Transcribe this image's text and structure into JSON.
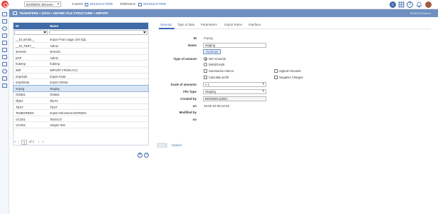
{
  "topbar": {
    "user_value": "BGREEN::BGreen",
    "current_label": "Current",
    "current_link": "201412ACT000",
    "reference_label": "Reference",
    "reference_link": "201312ACT000",
    "notification_count": "0",
    "help_glyph": "?",
    "brand_color": "#e8423c"
  },
  "titlebar": {
    "breadcrumb": "TRANSFERS » DATA » DEFINE FILE STRUCTURE » IMPORT",
    "right_text": "BGSBATCHadmin",
    "color": "#6e8fc0"
  },
  "grid": {
    "col_id": "ID",
    "col_name": "Name",
    "rows": [
      {
        "id": "__DI_BASE__",
        "name": "Import From Sage 100 SQL"
      },
      {
        "id": "__DI_TEST__",
        "name": "Admin"
      },
      {
        "id": "demo01",
        "name": "demo01"
      },
      {
        "id": "EXP",
        "name": "Admin"
      },
      {
        "id": "hubImp",
        "name": "hubImp"
      },
      {
        "id": "IMP",
        "name": "IMPORT FROM ACC"
      },
      {
        "id": "ImpHUB",
        "name": "Import HUB"
      },
      {
        "id": "ImpOData",
        "name": "Import OData"
      },
      {
        "id": "ImpSg",
        "name": "staging"
      },
      {
        "id": "Odata1",
        "name": "Odata1"
      },
      {
        "id": "rflp01",
        "name": "rflp 01"
      },
      {
        "id": "TEST",
        "name": "TEST"
      },
      {
        "id": "TestBGREEN",
        "name": "Import Structures BGREEN"
      },
      {
        "id": "VCO01",
        "name": "TestVCO"
      },
      {
        "id": "VCO02",
        "name": "Simple Test"
      }
    ],
    "selected_index": 8,
    "pager": {
      "first": "«",
      "prev": "‹",
      "page": "1",
      "of": "of 1",
      "next": "›",
      "last": "»"
    },
    "add_glyph": "+",
    "remove_glyph": "−"
  },
  "tabs": [
    "General",
    "Type of data",
    "Parameters",
    "Import Rules",
    "Interface"
  ],
  "form": {
    "id_label": "ID",
    "id_value": "ImpSg",
    "name_label": "Name",
    "name_value": "staging",
    "duplicate_label": "Duplicate",
    "type_label": "Type of amount",
    "type_options": [
      "Net Amounts",
      "Debit/Credit",
      "Summarize Interco",
      "Calculate profit",
      "Signed Amounts",
      "Negative Charges"
    ],
    "scale_label": "Scale of amounts",
    "scale_value": "x 1",
    "filetype_label": "File Type",
    "filetype_value": "Staging",
    "createdby_label": "Created by",
    "createdby_value": "BGREEN:admin",
    "on_label": "on",
    "on_value": "16-02-23 06:12:42",
    "modifiedby_label": "Modified by",
    "on2_label": "on",
    "save_label": "Save",
    "cancel_label": "Cancel"
  }
}
